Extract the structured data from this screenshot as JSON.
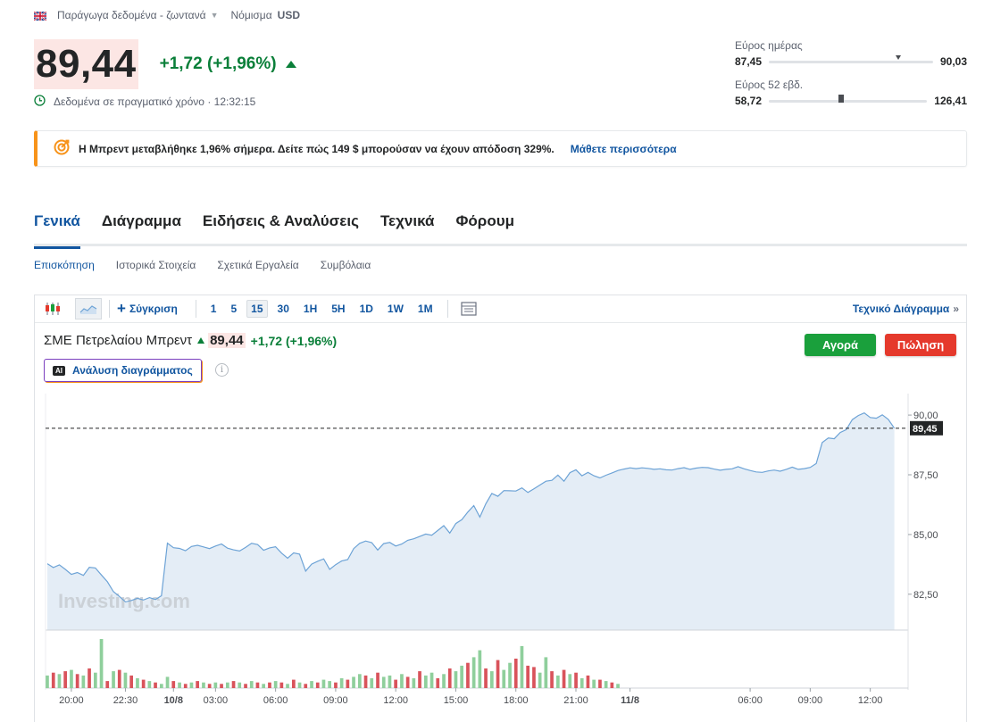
{
  "header": {
    "exchange": "Παράγωγα δεδομένα - ζωντανά",
    "currency_label": "Νόμισμα",
    "currency": "USD"
  },
  "quote": {
    "price": "89,44",
    "change": "+1,72 (+1,96%)",
    "realtime": "Δεδομένα σε πραγματικό χρόνο · 12:32:15"
  },
  "ranges": {
    "day": {
      "label": "Εύρος ημέρας",
      "low": "87,45",
      "high": "90,03",
      "position": 0.77
    },
    "week52": {
      "label": "Εύρος 52 εβδ.",
      "low": "58,72",
      "high": "126,41",
      "position": 0.44
    }
  },
  "banner": {
    "text": "Η Μπρεντ μεταβλήθηκε 1,96% σήμερα. Δείτε πώς 149 $ μπορούσαν να έχουν απόδοση 329%.",
    "link": "Μάθετε περισσότερα"
  },
  "tabs": [
    "Γενικά",
    "Διάγραμμα",
    "Ειδήσεις & Αναλύσεις",
    "Τεχνικά",
    "Φόρουμ"
  ],
  "subtabs": [
    "Επισκόπηση",
    "Ιστορικά Στοιχεία",
    "Σχετικά Εργαλεία",
    "Συμβόλαια"
  ],
  "toolbar": {
    "compare": "Σύγκριση",
    "intervals": [
      "1",
      "5",
      "15",
      "30",
      "1H",
      "5H",
      "1D",
      "1W",
      "1M"
    ],
    "active_interval": "15",
    "technical": "Τεχνικό Διάγραμμα"
  },
  "chart_header": {
    "symbol": "ΣΜΕ Πετρελαίου Μπρεντ",
    "price": "89,44",
    "change": "+1,72 (+1,96%)",
    "buy": "Αγορά",
    "sell": "Πώληση",
    "ai": "Ανάλυση διαγράμματος",
    "ai_badge": "AI"
  },
  "colors": {
    "accent": "#1256a0",
    "positive": "#0a7f39",
    "negative": "#e5392c",
    "line": "#6da3d6",
    "area": "#e4edf6",
    "vol_up": "#8fcf9c",
    "vol_down": "#d9535b"
  },
  "chart_data": {
    "type": "area",
    "watermark": "Investing.com",
    "last_price_label": "89,45",
    "last_price": 89.45,
    "ylim": [
      81.0,
      90.9
    ],
    "y_ticks": [
      82.5,
      85.0,
      87.5,
      90.0
    ],
    "y_tick_labels": [
      "82,50",
      "85,00",
      "87,50",
      "90,00"
    ],
    "x_tick_labels": [
      "20:00",
      "22:30",
      "10/8",
      "03:00",
      "06:00",
      "09:00",
      "12:00",
      "15:00",
      "18:00",
      "21:00",
      "11/8",
      "06:00",
      "09:00",
      "12:00"
    ],
    "x_tick_index": [
      4,
      13,
      21,
      28,
      38,
      48,
      58,
      68,
      78,
      88,
      97,
      117,
      127,
      137
    ],
    "x_tick_bold": [
      false,
      false,
      true,
      false,
      false,
      false,
      false,
      false,
      false,
      false,
      true,
      false,
      false,
      false
    ],
    "series": [
      {
        "name": "",
        "values": [
          83.78,
          83.62,
          83.73,
          83.54,
          83.33,
          83.41,
          83.29,
          83.63,
          83.6,
          83.31,
          83.02,
          82.61,
          82.41,
          82.18,
          82.24,
          82.33,
          82.26,
          82.36,
          82.28,
          82.44,
          84.64,
          84.45,
          84.42,
          84.32,
          84.5,
          84.55,
          84.48,
          84.41,
          84.52,
          84.6,
          84.43,
          84.36,
          84.31,
          84.46,
          84.63,
          84.58,
          84.34,
          84.44,
          84.49,
          84.22,
          84.01,
          84.23,
          84.18,
          83.47,
          83.76,
          83.88,
          83.98,
          83.54,
          83.74,
          83.89,
          83.95,
          84.41,
          84.63,
          84.73,
          84.66,
          84.35,
          84.62,
          84.67,
          84.52,
          84.6,
          84.76,
          84.82,
          84.92,
          85.02,
          84.97,
          85.17,
          85.37,
          85.06,
          85.46,
          85.62,
          85.94,
          86.21,
          85.73,
          86.29,
          86.72,
          86.6,
          86.84,
          86.83,
          86.82,
          86.95,
          86.76,
          86.91,
          87.07,
          87.23,
          87.27,
          87.49,
          87.23,
          87.59,
          87.71,
          87.46,
          87.6,
          87.46,
          87.37,
          87.48,
          87.58,
          87.68,
          87.74,
          87.79,
          87.76,
          87.79,
          87.77,
          87.73,
          87.75,
          87.71,
          87.7,
          87.76,
          87.8,
          87.73,
          87.78,
          87.81,
          87.8,
          87.74,
          87.69,
          87.73,
          87.75,
          87.84,
          87.75,
          87.68,
          87.62,
          87.6,
          87.66,
          87.7,
          87.65,
          87.73,
          87.82,
          87.73,
          87.76,
          87.81,
          87.97,
          88.85,
          89.04,
          89.01,
          89.27,
          89.39,
          89.81,
          89.98,
          90.09,
          89.9,
          89.87,
          90.01,
          89.82,
          89.45
        ]
      }
    ],
    "volume": {
      "values": [
        9,
        11,
        10,
        12,
        13,
        10,
        9,
        14,
        11,
        35,
        5,
        12,
        13,
        11,
        9,
        7,
        6,
        5,
        4,
        3,
        8,
        5,
        4,
        3,
        4,
        5,
        4,
        3,
        4,
        3,
        4,
        5,
        4,
        3,
        5,
        4,
        3,
        4,
        5,
        4,
        3,
        6,
        4,
        3,
        5,
        4,
        6,
        5,
        4,
        7,
        6,
        8,
        10,
        9,
        7,
        11,
        8,
        9,
        6,
        10,
        8,
        7,
        12,
        9,
        11,
        7,
        10,
        14,
        12,
        16,
        18,
        22,
        27,
        14,
        12,
        20,
        13,
        18,
        21,
        30,
        16,
        15,
        11,
        22,
        12,
        9,
        13,
        10,
        11,
        7,
        9,
        6,
        6,
        5,
        4,
        3,
        0,
        0,
        0,
        0,
        0,
        0,
        0,
        0,
        0,
        0,
        0,
        0,
        0,
        0,
        0,
        0,
        0,
        0,
        0,
        0,
        0,
        0,
        0,
        0,
        0,
        0,
        0,
        0,
        0,
        0,
        0,
        0,
        0,
        0,
        0,
        0,
        0,
        0,
        0,
        0,
        0,
        0,
        0,
        0,
        0,
        0
      ],
      "up": [
        true,
        false,
        true,
        false,
        true,
        false,
        true,
        false,
        true,
        true,
        false,
        true,
        false,
        true,
        false,
        true,
        false,
        true,
        false,
        true,
        true,
        false,
        true,
        false,
        true,
        false,
        true,
        false,
        true,
        false,
        true,
        false,
        true,
        false,
        true,
        false,
        true,
        false,
        true,
        false,
        true,
        false,
        true,
        false,
        true,
        false,
        true,
        true,
        false,
        true,
        false,
        true,
        true,
        false,
        true,
        false,
        true,
        true,
        false,
        true,
        false,
        true,
        false,
        true,
        true,
        false,
        true,
        false,
        true,
        true,
        false,
        true,
        true,
        false,
        true,
        false,
        true,
        true,
        false,
        true,
        false,
        false,
        true,
        true,
        false,
        true,
        false,
        true,
        false,
        true,
        false,
        true,
        false,
        true,
        false,
        true,
        true,
        true,
        true,
        true,
        true,
        true,
        true,
        true,
        true,
        true,
        true,
        true,
        true,
        true,
        true,
        true,
        true,
        true,
        true,
        true,
        true,
        true,
        true,
        true,
        true,
        true,
        true,
        true,
        true,
        true,
        true,
        true,
        true,
        true,
        true,
        true,
        true,
        true,
        true,
        true,
        true,
        true,
        true,
        true,
        true,
        true
      ]
    }
  }
}
